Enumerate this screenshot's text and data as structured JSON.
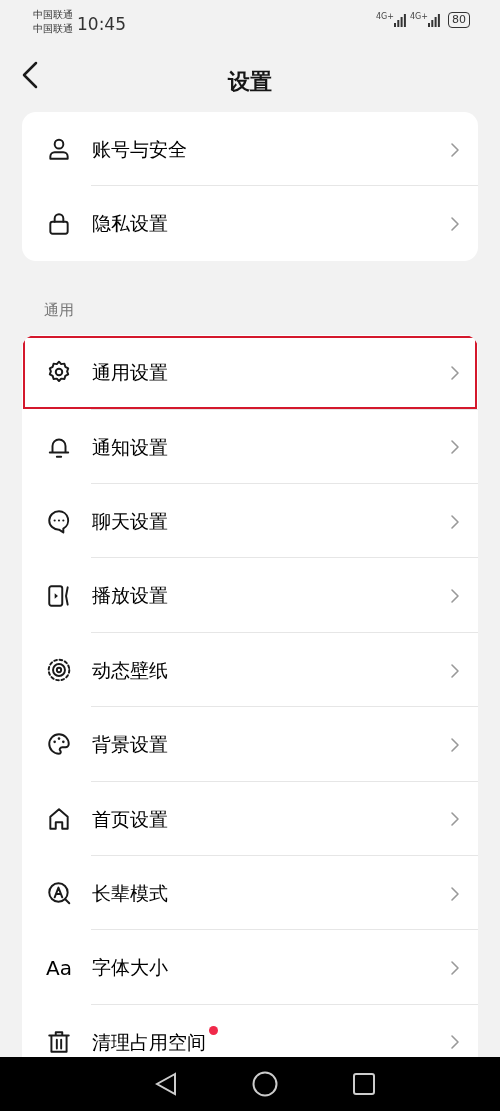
{
  "status_bar": {
    "carriers": [
      "中国联通",
      "中国联通"
    ],
    "time": "10:45",
    "networks": [
      "4G+",
      "4G+"
    ],
    "battery": "80"
  },
  "header": {
    "title": "设置"
  },
  "groups": [
    {
      "items": [
        {
          "label": "账号与安全",
          "highlighted": false,
          "dot": false
        },
        {
          "label": "隐私设置",
          "highlighted": false,
          "dot": false
        }
      ]
    },
    {
      "section": "通用",
      "items": [
        {
          "label": "通用设置",
          "highlighted": true,
          "dot": false
        },
        {
          "label": "通知设置",
          "highlighted": false,
          "dot": false
        },
        {
          "label": "聊天设置",
          "highlighted": false,
          "dot": false
        },
        {
          "label": "播放设置",
          "highlighted": false,
          "dot": false
        },
        {
          "label": "动态壁纸",
          "highlighted": false,
          "dot": false
        },
        {
          "label": "背景设置",
          "highlighted": false,
          "dot": false
        },
        {
          "label": "首页设置",
          "highlighted": false,
          "dot": false
        },
        {
          "label": "长辈模式",
          "highlighted": false,
          "dot": false
        },
        {
          "label": "字体大小",
          "glyph": "Aa",
          "highlighted": false,
          "dot": false
        },
        {
          "label": "清理占用空间",
          "highlighted": false,
          "dot": true
        }
      ]
    }
  ]
}
